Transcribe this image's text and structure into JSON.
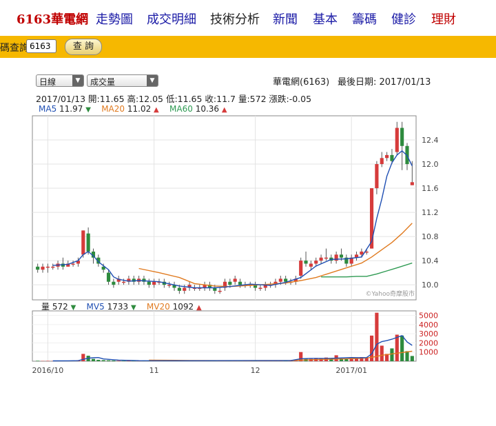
{
  "nav": {
    "brand": "6163華電網",
    "items": [
      {
        "label": "走勢圖",
        "style": "blue"
      },
      {
        "label": "成交明細",
        "style": "blue"
      },
      {
        "label": "技術分析",
        "style": "dark"
      },
      {
        "label": "新聞",
        "style": "blue"
      },
      {
        "label": "基本",
        "style": "blue"
      },
      {
        "label": "籌碼",
        "style": "blue"
      },
      {
        "label": "健診",
        "style": "blue"
      },
      {
        "label": "理財",
        "style": "red"
      }
    ]
  },
  "query": {
    "label": "代號查詢",
    "label_visible": "碼查詢",
    "value": "6163",
    "button": "查 詢"
  },
  "controls": {
    "period": "日線",
    "indicator": "成交量"
  },
  "header": {
    "stock": "華電網(6163)",
    "last_date": "最後日期: 2017/01/13"
  },
  "ohlc_line": "2017/01/13  開:11.65 高:12.05 低:11.65 收:11.7 量:572 漲跌:-0.05",
  "ma_labels": [
    {
      "name": "MA5",
      "value": "11.97",
      "dir": "down",
      "color": "#1f4fb3"
    },
    {
      "name": "MA20",
      "value": "11.02",
      "dir": "up",
      "color": "#e07a1f"
    },
    {
      "name": "MA60",
      "value": "10.36",
      "dir": "up",
      "color": "#2e9a52"
    }
  ],
  "vol_labels": [
    {
      "name": "量",
      "value": "572",
      "dir": "down",
      "color": "#222"
    },
    {
      "name": "MV5",
      "value": "1733",
      "dir": "down",
      "color": "#1f4fb3"
    },
    {
      "name": "MV20",
      "value": "1092",
      "dir": "up",
      "color": "#e07a1f"
    }
  ],
  "watermark": "©Yahoo奇摩股市",
  "colors": {
    "up": "#d63b3b",
    "down": "#2e8b3e",
    "ma5": "#1f4fb3",
    "ma20": "#e07a1f",
    "ma60": "#2e9a52",
    "axis_red": "#cc2222"
  },
  "chart_data": {
    "type": "candlestick",
    "x_tick_labels": [
      "2016/10",
      "11",
      "12",
      "2017/01"
    ],
    "x_tick_index": [
      2,
      23,
      43,
      62
    ],
    "ylim": [
      9.75,
      12.8
    ],
    "yticks": [
      10.0,
      10.4,
      10.8,
      11.2,
      11.6,
      12.0,
      12.4
    ],
    "ohlc": [
      [
        10.3,
        10.35,
        10.2,
        10.25
      ],
      [
        10.25,
        10.35,
        10.2,
        10.3
      ],
      [
        10.3,
        10.35,
        10.2,
        10.3
      ],
      [
        10.3,
        10.35,
        10.25,
        10.3
      ],
      [
        10.3,
        10.4,
        10.25,
        10.35
      ],
      [
        10.35,
        10.45,
        10.25,
        10.3
      ],
      [
        10.3,
        10.4,
        10.3,
        10.35
      ],
      [
        10.35,
        10.4,
        10.3,
        10.35
      ],
      [
        10.35,
        10.45,
        10.3,
        10.4
      ],
      [
        10.5,
        10.9,
        10.45,
        10.9
      ],
      [
        10.85,
        10.95,
        10.5,
        10.55
      ],
      [
        10.55,
        10.6,
        10.35,
        10.45
      ],
      [
        10.45,
        10.5,
        10.3,
        10.35
      ],
      [
        10.3,
        10.35,
        10.2,
        10.25
      ],
      [
        10.2,
        10.25,
        10.0,
        10.05
      ],
      [
        10.05,
        10.1,
        9.95,
        10.0
      ],
      [
        10.05,
        10.15,
        10.0,
        10.1
      ],
      [
        10.05,
        10.1,
        10.0,
        10.05
      ],
      [
        10.05,
        10.15,
        10.0,
        10.1
      ],
      [
        10.1,
        10.15,
        10.0,
        10.05
      ],
      [
        10.05,
        10.15,
        10.0,
        10.1
      ],
      [
        10.1,
        10.15,
        10.0,
        10.05
      ],
      [
        10.05,
        10.1,
        9.95,
        10.0
      ],
      [
        10.0,
        10.1,
        9.95,
        10.05
      ],
      [
        10.05,
        10.1,
        10.0,
        10.05
      ],
      [
        10.05,
        10.1,
        9.95,
        10.0
      ],
      [
        10.0,
        10.05,
        9.95,
        10.0
      ],
      [
        10.0,
        10.05,
        9.9,
        9.95
      ],
      [
        9.95,
        10.0,
        9.85,
        9.9
      ],
      [
        9.9,
        10.0,
        9.85,
        9.95
      ],
      [
        9.95,
        10.05,
        9.9,
        10.0
      ],
      [
        9.95,
        10.0,
        9.9,
        9.95
      ],
      [
        9.95,
        10.0,
        9.9,
        9.95
      ],
      [
        9.95,
        10.05,
        9.9,
        10.0
      ],
      [
        10.0,
        10.05,
        9.9,
        9.95
      ],
      [
        9.95,
        10.0,
        9.85,
        9.9
      ],
      [
        9.9,
        9.95,
        9.85,
        9.9
      ],
      [
        9.95,
        10.1,
        9.9,
        10.05
      ],
      [
        10.05,
        10.1,
        9.95,
        10.0
      ],
      [
        10.05,
        10.15,
        10.0,
        10.1
      ],
      [
        10.05,
        10.1,
        9.95,
        10.0
      ],
      [
        10.0,
        10.05,
        9.95,
        10.0
      ],
      [
        10.0,
        10.05,
        9.95,
        10.0
      ],
      [
        10.0,
        10.05,
        9.9,
        9.95
      ],
      [
        9.95,
        10.0,
        9.9,
        9.95
      ],
      [
        9.95,
        10.05,
        9.9,
        10.0
      ],
      [
        10.0,
        10.05,
        9.95,
        10.0
      ],
      [
        10.0,
        10.1,
        9.95,
        10.05
      ],
      [
        10.05,
        10.15,
        10.0,
        10.1
      ],
      [
        10.1,
        10.15,
        10.0,
        10.05
      ],
      [
        10.05,
        10.1,
        10.0,
        10.05
      ],
      [
        10.05,
        10.15,
        10.0,
        10.1
      ],
      [
        10.15,
        10.45,
        10.1,
        10.4
      ],
      [
        10.4,
        10.55,
        10.3,
        10.35
      ],
      [
        10.3,
        10.4,
        10.25,
        10.35
      ],
      [
        10.35,
        10.45,
        10.3,
        10.4
      ],
      [
        10.4,
        10.5,
        10.35,
        10.45
      ],
      [
        10.45,
        10.6,
        10.4,
        10.45
      ],
      [
        10.45,
        10.5,
        10.35,
        10.4
      ],
      [
        10.4,
        10.55,
        10.35,
        10.5
      ],
      [
        10.5,
        10.6,
        10.4,
        10.45
      ],
      [
        10.45,
        10.5,
        10.3,
        10.35
      ],
      [
        10.35,
        10.5,
        10.3,
        10.45
      ],
      [
        10.45,
        10.55,
        10.4,
        10.5
      ],
      [
        10.5,
        10.6,
        10.45,
        10.55
      ],
      [
        10.55,
        10.6,
        10.5,
        10.55
      ],
      [
        10.6,
        11.6,
        10.6,
        11.6
      ],
      [
        11.6,
        12.05,
        11.5,
        12.0
      ],
      [
        12.0,
        12.2,
        11.95,
        12.1
      ],
      [
        12.1,
        12.2,
        12.05,
        12.15
      ],
      [
        12.15,
        12.25,
        12.0,
        12.05
      ],
      [
        12.2,
        12.7,
        12.15,
        12.6
      ],
      [
        12.6,
        12.7,
        11.9,
        12.3
      ],
      [
        12.3,
        12.35,
        11.9,
        12.0
      ],
      [
        11.65,
        12.05,
        11.65,
        11.7
      ]
    ],
    "ma5": [
      [
        3,
        10.32
      ],
      [
        6,
        10.34
      ],
      [
        8,
        10.4
      ],
      [
        9,
        10.5
      ],
      [
        10,
        10.55
      ],
      [
        11,
        10.48
      ],
      [
        12,
        10.38
      ],
      [
        14,
        10.25
      ],
      [
        15,
        10.13
      ],
      [
        16,
        10.09
      ],
      [
        18,
        10.06
      ],
      [
        20,
        10.07
      ],
      [
        24,
        10.05
      ],
      [
        28,
        9.98
      ],
      [
        31,
        9.95
      ],
      [
        35,
        9.95
      ],
      [
        38,
        9.97
      ],
      [
        42,
        10.01
      ],
      [
        46,
        9.99
      ],
      [
        49,
        10.04
      ],
      [
        52,
        10.12
      ],
      [
        55,
        10.31
      ],
      [
        58,
        10.42
      ],
      [
        61,
        10.43
      ],
      [
        64,
        10.46
      ],
      [
        66,
        10.72
      ],
      [
        67,
        11.1
      ],
      [
        68,
        11.42
      ],
      [
        69,
        11.8
      ],
      [
        70,
        12.02
      ],
      [
        71,
        12.15
      ],
      [
        72,
        12.22
      ],
      [
        73,
        12.14
      ],
      [
        74,
        11.97
      ]
    ],
    "ma20": [
      [
        20,
        10.27
      ],
      [
        24,
        10.2
      ],
      [
        28,
        10.12
      ],
      [
        31,
        10.02
      ],
      [
        35,
        9.98
      ],
      [
        38,
        9.97
      ],
      [
        42,
        9.99
      ],
      [
        46,
        10.01
      ],
      [
        49,
        10.03
      ],
      [
        52,
        10.07
      ],
      [
        55,
        10.12
      ],
      [
        58,
        10.2
      ],
      [
        61,
        10.28
      ],
      [
        64,
        10.36
      ],
      [
        66,
        10.46
      ],
      [
        68,
        10.58
      ],
      [
        70,
        10.7
      ],
      [
        72,
        10.85
      ],
      [
        74,
        11.02
      ]
    ],
    "ma60": [
      [
        56,
        10.13
      ],
      [
        58,
        10.13
      ],
      [
        61,
        10.13
      ],
      [
        63,
        10.14
      ],
      [
        65,
        10.14
      ],
      [
        67,
        10.18
      ],
      [
        69,
        10.23
      ],
      [
        71,
        10.28
      ],
      [
        74,
        10.36
      ]
    ],
    "volume_ylim": [
      0,
      5500
    ],
    "volume_yticks": [
      1000,
      2000,
      3000,
      4000,
      5000
    ],
    "volume": [
      50,
      30,
      40,
      30,
      40,
      50,
      60,
      80,
      100,
      800,
      600,
      250,
      150,
      120,
      100,
      80,
      50,
      40,
      50,
      40,
      60,
      50,
      40,
      50,
      40,
      60,
      50,
      80,
      60,
      40,
      50,
      60,
      70,
      80,
      50,
      40,
      30,
      80,
      60,
      70,
      100,
      60,
      50,
      50,
      40,
      60,
      70,
      80,
      90,
      70,
      50,
      60,
      1000,
      300,
      250,
      350,
      300,
      400,
      350,
      650,
      300,
      300,
      400,
      350,
      450,
      400,
      2800,
      5300,
      1700,
      800,
      1400,
      2900,
      2800,
      1100,
      572
    ],
    "mv5": [
      [
        3,
        40
      ],
      [
        6,
        45
      ],
      [
        8,
        60
      ],
      [
        9,
        200
      ],
      [
        10,
        330
      ],
      [
        11,
        380
      ],
      [
        12,
        400
      ],
      [
        13,
        250
      ],
      [
        16,
        120
      ],
      [
        20,
        60
      ],
      [
        30,
        55
      ],
      [
        40,
        70
      ],
      [
        50,
        65
      ],
      [
        52,
        270
      ],
      [
        54,
        310
      ],
      [
        58,
        320
      ],
      [
        62,
        400
      ],
      [
        64,
        380
      ],
      [
        65,
        400
      ],
      [
        66,
        800
      ],
      [
        67,
        1850
      ],
      [
        68,
        2150
      ],
      [
        69,
        2250
      ],
      [
        70,
        2400
      ],
      [
        71,
        2600
      ],
      [
        72,
        2800
      ],
      [
        73,
        2100
      ],
      [
        74,
        1733
      ]
    ],
    "mv20": [
      [
        22,
        120
      ],
      [
        30,
        80
      ],
      [
        40,
        60
      ],
      [
        50,
        80
      ],
      [
        55,
        180
      ],
      [
        60,
        240
      ],
      [
        64,
        320
      ],
      [
        66,
        420
      ],
      [
        68,
        650
      ],
      [
        70,
        800
      ],
      [
        72,
        950
      ],
      [
        74,
        1092
      ]
    ]
  }
}
